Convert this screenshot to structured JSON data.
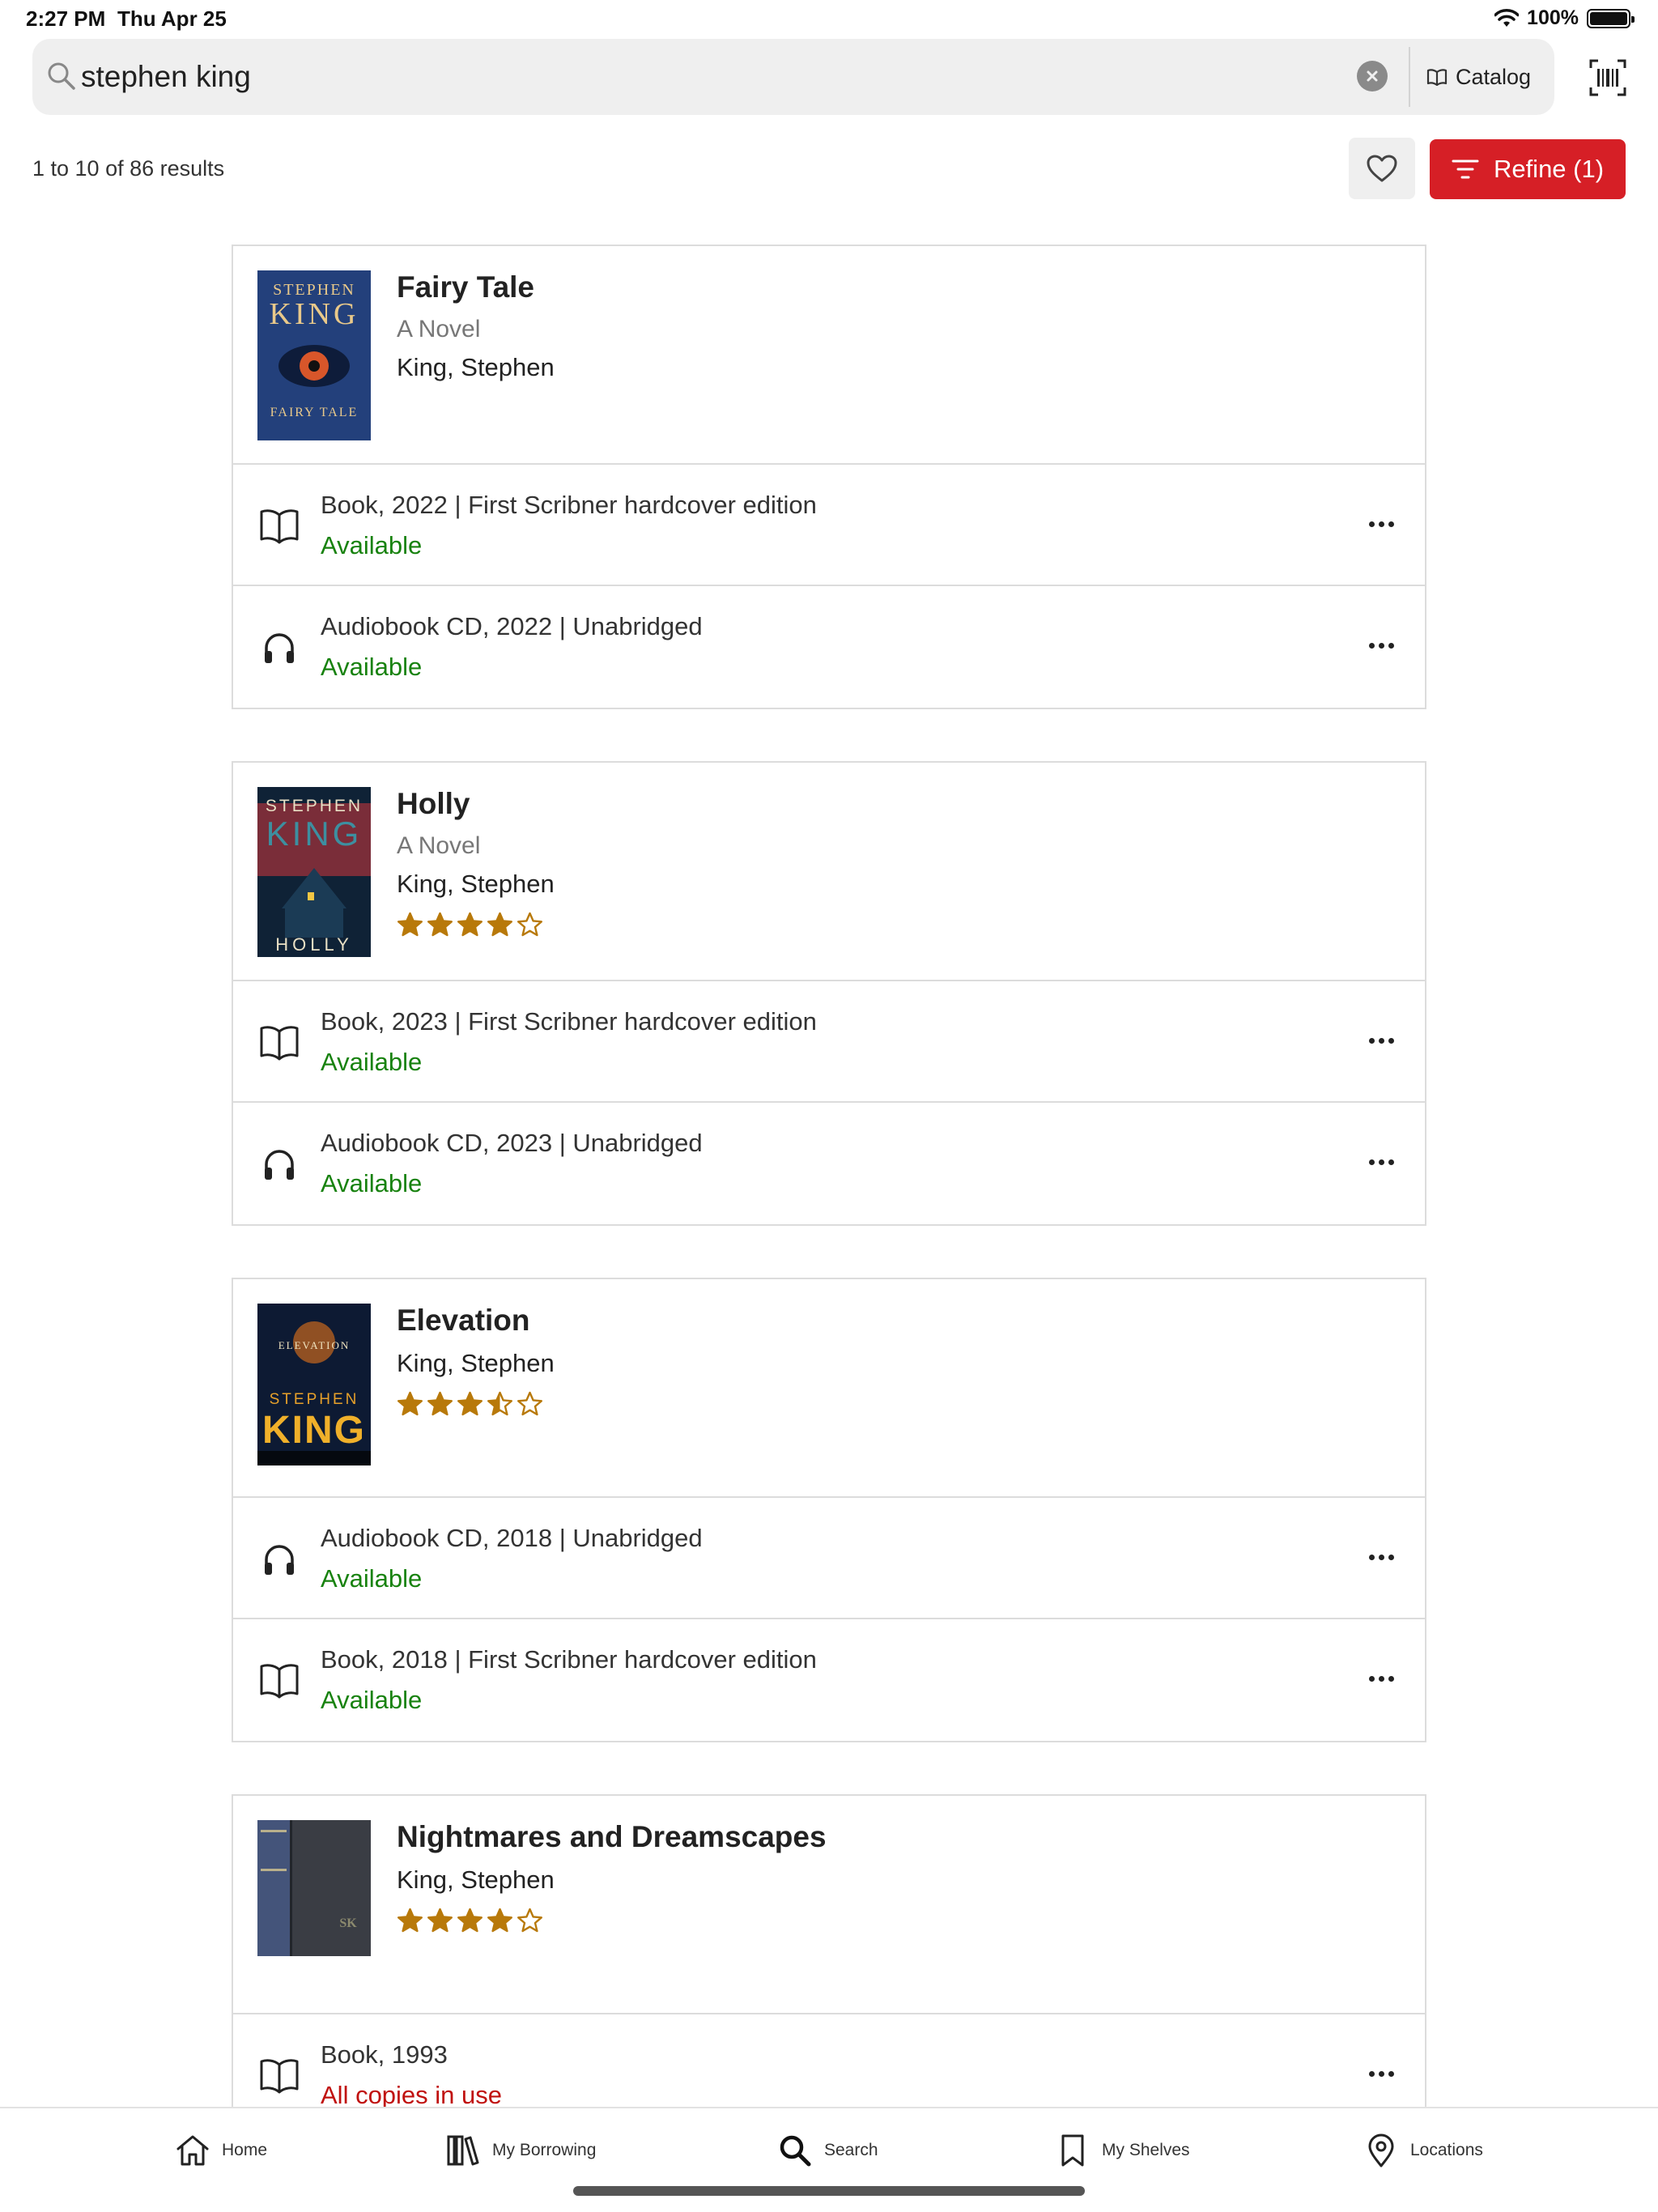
{
  "status_bar": {
    "time": "2:27 PM",
    "date": "Thu Apr 25",
    "battery": "100%"
  },
  "search": {
    "query": "stephen king",
    "placeholder": "",
    "catalog_label": "Catalog"
  },
  "results": {
    "count_text": "1 to 10 of 86 results",
    "refine_label": "Refine (1)"
  },
  "colors": {
    "accent": "#d61f26",
    "available": "#18820f",
    "unavailable": "#c0110f",
    "star": "#b8790a"
  },
  "items": [
    {
      "title": "Fairy Tale",
      "subtitle": "A Novel",
      "author": "King, Stephen",
      "rating": 0,
      "cover_text": {
        "top": "STEPHEN",
        "main": "KING",
        "bottom": "FAIRY TALE"
      },
      "formats": [
        {
          "icon": "book-icon",
          "label": "Book, 2022 | First Scribner hardcover edition",
          "status": "Available"
        },
        {
          "icon": "headphones-icon",
          "label": "Audiobook CD, 2022 | Unabridged",
          "status": "Available"
        }
      ]
    },
    {
      "title": "Holly",
      "subtitle": "A Novel",
      "author": "King, Stephen",
      "rating": 4,
      "cover_text": {
        "top": "STEPHEN",
        "main": "KING",
        "bottom": "HOLLY"
      },
      "formats": [
        {
          "icon": "book-icon",
          "label": "Book, 2023 | First Scribner hardcover edition",
          "status": "Available"
        },
        {
          "icon": "headphones-icon",
          "label": "Audiobook CD, 2023 | Unabridged",
          "status": "Available"
        }
      ]
    },
    {
      "title": "Elevation",
      "subtitle": "",
      "author": "King, Stephen",
      "rating": 3.5,
      "cover_text": {
        "top": "ELEVATION",
        "main": "STEPHEN",
        "bottom": "KING"
      },
      "formats": [
        {
          "icon": "headphones-icon",
          "label": "Audiobook CD, 2018 | Unabridged",
          "status": "Available"
        },
        {
          "icon": "book-icon",
          "label": "Book, 2018 | First Scribner hardcover edition",
          "status": "Available"
        }
      ]
    },
    {
      "title": "Nightmares and Dreamscapes",
      "subtitle": "",
      "author": "King, Stephen",
      "rating": 4,
      "cover_text": {
        "top": "",
        "main": "SK",
        "bottom": ""
      },
      "formats": [
        {
          "icon": "book-icon",
          "label": "Book, 1993",
          "status": "All copies in use"
        }
      ]
    }
  ],
  "tabs": [
    {
      "label": "Home",
      "icon": "home-icon"
    },
    {
      "label": "My Borrowing",
      "icon": "books-icon"
    },
    {
      "label": "Search",
      "icon": "search-icon"
    },
    {
      "label": "My Shelves",
      "icon": "bookmark-icon"
    },
    {
      "label": "Locations",
      "icon": "location-pin-icon"
    }
  ]
}
